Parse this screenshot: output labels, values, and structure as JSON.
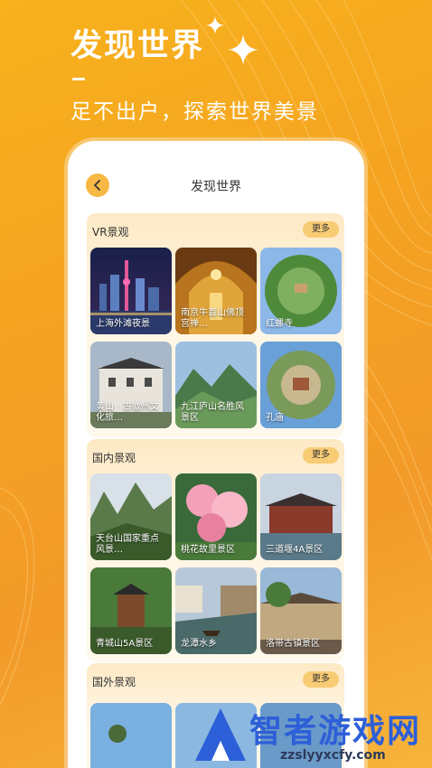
{
  "hero": {
    "title": "发现世界",
    "subtitle": "足不出户，探索世界美景"
  },
  "topbar": {
    "title": "发现世界",
    "back_icon": "chevron-left-icon"
  },
  "sections": [
    {
      "title": "VR景观",
      "more": "更多",
      "items": [
        {
          "label": "上海外滩夜景"
        },
        {
          "label": "南京牛首山佛顶宫禅…"
        },
        {
          "label": "红螺寺"
        },
        {
          "label": "黄山 · 古徽州文化旅…"
        },
        {
          "label": "九江庐山名胜风景区"
        },
        {
          "label": "孔庙"
        }
      ]
    },
    {
      "title": "国内景观",
      "more": "更多",
      "items": [
        {
          "label": "天台山国家重点风景…"
        },
        {
          "label": "桃花故里景区"
        },
        {
          "label": "三道堰4A景区"
        },
        {
          "label": "青城山5A景区"
        },
        {
          "label": "龙潭水乡"
        },
        {
          "label": "洛带古镇景区"
        }
      ]
    },
    {
      "title": "国外景观",
      "more": "更多",
      "items": []
    }
  ],
  "watermark": {
    "text": "智者游戏网",
    "url": "zzslyyxcfy.com"
  },
  "colors": {
    "background": "#f5a321",
    "accent": "#f7b844",
    "more_button": "#f8cc74",
    "watermark": "#2d5fd8"
  }
}
